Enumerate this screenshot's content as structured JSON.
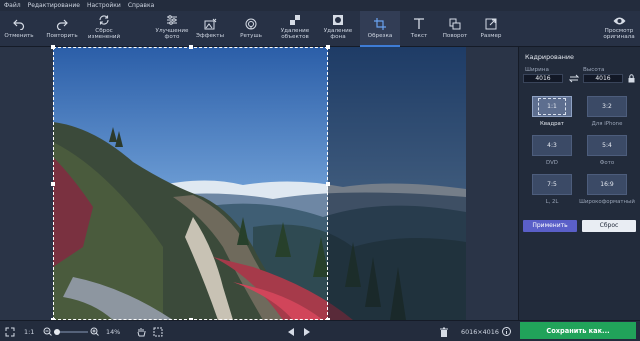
{
  "menu": [
    "Файл",
    "Редактирование",
    "Настройки",
    "Справка"
  ],
  "toolbar": {
    "undo": "Отменить",
    "redo": "Повторить",
    "reset_line1": "Сброс",
    "reset_line2": "изменений",
    "enhance_line1": "Улучшение",
    "enhance_line2": "фото",
    "effects": "Эффекты",
    "retouch": "Ретушь",
    "remove_obj_line1": "Удаление",
    "remove_obj_line2": "объектов",
    "remove_bg_line1": "Удаление",
    "remove_bg_line2": "фона",
    "crop": "Обрезка",
    "text": "Текст",
    "rotate": "Поворот",
    "resize": "Размер",
    "preview_line1": "Просмотр",
    "preview_line2": "оригинала"
  },
  "panel": {
    "title": "Кадрирование",
    "width_label": "Ширина",
    "height_label": "Высота",
    "width_value": "4016",
    "height_value": "4016",
    "ratios": [
      {
        "ratio": "1:1",
        "label": "Квадрат"
      },
      {
        "ratio": "3:2",
        "label": "Для iPhone"
      },
      {
        "ratio": "4:3",
        "label": "DVD"
      },
      {
        "ratio": "5:4",
        "label": "Фото"
      },
      {
        "ratio": "7:5",
        "label": "L, 2L"
      },
      {
        "ratio": "16:9",
        "label": "Широкоформатный"
      }
    ],
    "apply": "Применить",
    "reset": "Сброс"
  },
  "bottom": {
    "actual_size": "1:1",
    "zoom": "14%",
    "dimensions": "6016×4016",
    "save": "Сохранить как..."
  },
  "colors": {
    "accent": "#3e7cd6",
    "save": "#21a35a",
    "apply": "#5a5fc8"
  }
}
